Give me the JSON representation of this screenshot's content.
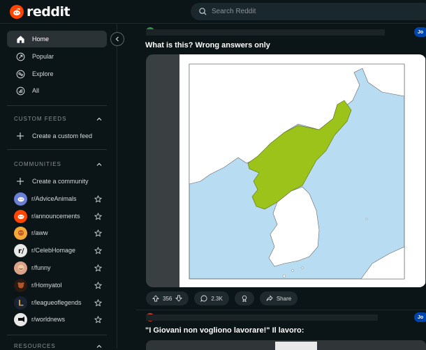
{
  "header": {
    "logo_text": "reddit",
    "search_placeholder": "Search Reddit"
  },
  "nav": [
    {
      "label": "Home",
      "icon": "home-icon",
      "active": true
    },
    {
      "label": "Popular",
      "icon": "popular-icon"
    },
    {
      "label": "Explore",
      "icon": "explore-icon"
    },
    {
      "label": "All",
      "icon": "all-icon"
    }
  ],
  "custom_feeds": {
    "heading": "CUSTOM FEEDS",
    "create_label": "Create a custom feed"
  },
  "communities": {
    "heading": "COMMUNITIES",
    "create_label": "Create a community",
    "items": [
      {
        "name": "r/AdviceAnimals",
        "color": "#6a7fd6"
      },
      {
        "name": "r/announcements",
        "color": "#ff4500"
      },
      {
        "name": "r/aww",
        "color": "#f4a93b"
      },
      {
        "name": "r/CelebHomage",
        "color": "#e8e8e8"
      },
      {
        "name": "r/funny",
        "color": "#d9a38a"
      },
      {
        "name": "r/Homyatol",
        "color": "#2b1a12"
      },
      {
        "name": "r/leagueoflegends",
        "color": "#c89b3c"
      },
      {
        "name": "r/worldnews",
        "color": "#e8e8e8"
      }
    ]
  },
  "resources": {
    "heading": "RESOURCES"
  },
  "posts": [
    {
      "title": "What is this? Wrong answers only",
      "join_label": "Jo",
      "upvotes": "356",
      "comments": "2.3K",
      "share_label": "Share"
    },
    {
      "title": "\"I Giovani non vogliono lavorare!\" Il lavoro:",
      "join_label": "Jo"
    }
  ],
  "colors": {
    "background": "#0b1416",
    "accent": "#ff4500",
    "join": "#0045ac",
    "map_land_highlight": "#9bc31a",
    "map_water": "#b8dcf2"
  }
}
